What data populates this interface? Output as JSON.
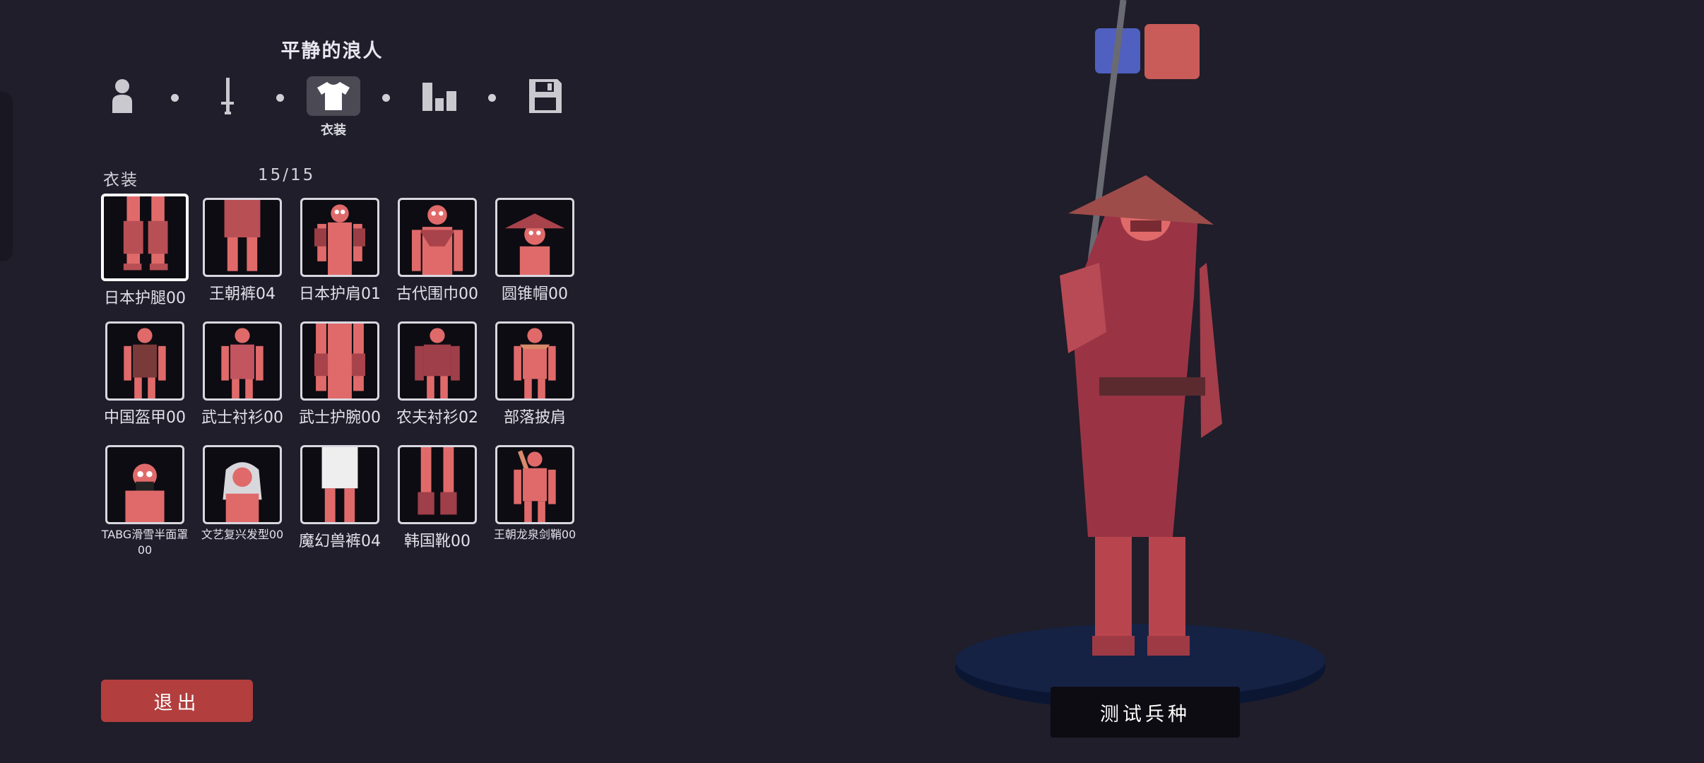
{
  "unit_name": "平静的浪人",
  "steps": [
    {
      "icon": "unit-person-icon",
      "active": false
    },
    {
      "icon": "sword-icon",
      "active": false
    },
    {
      "icon": "shirt-icon",
      "active": true,
      "label": "衣装"
    },
    {
      "icon": "stats-bars-icon",
      "active": false
    },
    {
      "icon": "save-disk-icon",
      "active": false
    }
  ],
  "section": {
    "label": "衣装",
    "count": "15/15"
  },
  "items": [
    {
      "name": "日本护腿00",
      "selected": true
    },
    {
      "name": "王朝裤04"
    },
    {
      "name": "日本护肩01"
    },
    {
      "name": "古代围巾00"
    },
    {
      "name": "圆锥帽00"
    },
    {
      "name": "中国盔甲00"
    },
    {
      "name": "武士衬衫00"
    },
    {
      "name": "武士护腕00"
    },
    {
      "name": "农夫衬衫02"
    },
    {
      "name": "部落披肩"
    },
    {
      "name": "TABG滑雪半面罩00"
    },
    {
      "name": "文艺复兴发型00"
    },
    {
      "name": "魔幻兽裤04"
    },
    {
      "name": "韩国靴00"
    },
    {
      "name": "王朝龙泉剑鞘00"
    }
  ],
  "exit_label": "退出",
  "test_label": "测试兵种",
  "colors": {
    "team_blue": "#4f60c0",
    "team_red": "#c95b58",
    "exit": "#b23e3e",
    "unit": "#e06a6a"
  }
}
